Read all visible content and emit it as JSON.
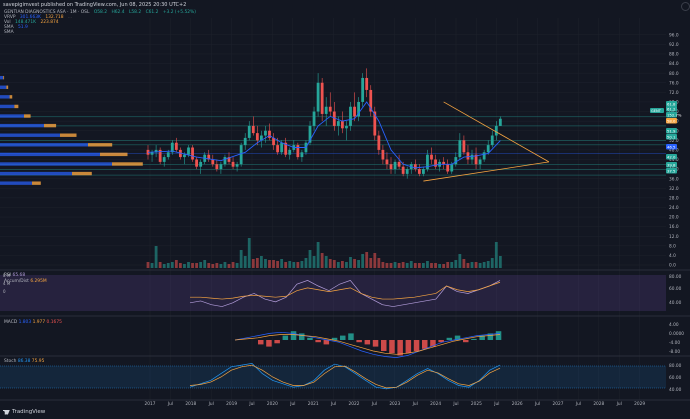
{
  "header": {
    "publisher": "savepigimvest published on TradingView.com, Jun 08, 2025 20:30 UTC+2"
  },
  "legend": {
    "symbol_line": {
      "name": "GENTIAN DIAGNOSTICS ASA · 1M · OSL",
      "o": "O58.2",
      "h": "H62.4",
      "l": "L58.2",
      "c": "C61.2",
      "chg": "+3.2 (+5.52%)"
    },
    "vrvp": {
      "name": "VRVP",
      "values": [
        "301.663K",
        "132.718",
        "..."
      ]
    },
    "vol": {
      "name": "Vol",
      "values": [
        "148.471K",
        "223.874"
      ]
    },
    "sma1": {
      "name": "SMA",
      "value": "51.9"
    },
    "sma2": {
      "name": "SMA",
      "value": ""
    }
  },
  "panes": {
    "rsi_label": {
      "name": "RSI",
      "value": "65.68"
    },
    "accum_label": {
      "name": "Accum/Dist",
      "value": "6.295M"
    },
    "macd_label": {
      "name": "MACD",
      "v1": "1.803",
      "v2": "1.977",
      "v3": "0.1675"
    },
    "stoch_label": {
      "name": "Stoch",
      "v1": "86.38",
      "v2": "75.95"
    }
  },
  "colors": {
    "bg": "#131722",
    "grid": "#1e222d",
    "up": "#26a69a",
    "down": "#ef5350",
    "sma": "#2962ff",
    "trend": "#f7a541",
    "rsi_band": "#7e57c2",
    "stoch_band": "#2196f3",
    "axis_text": "#b2b5be"
  },
  "chart_data": [
    {
      "type": "candlestick",
      "title": "GENTIAN DIAGNOSTICS ASA · 1M · OSL",
      "y_ticks": [
        "96.0",
        "92.0",
        "88.0",
        "84.0",
        "80.0",
        "76.0",
        "72.0",
        "68.0",
        "64.0",
        "60.0",
        "56.0",
        "52.0",
        "48.0",
        "44.0",
        "40.0",
        "36.0",
        "32.0",
        "28.0",
        "24.0",
        "20.0",
        "16.0",
        "12.0",
        "8.0",
        "4.0",
        "0.0"
      ],
      "ylim": [
        0,
        98
      ],
      "x_ticks": [
        "2017",
        "Jul",
        "2018",
        "Jul",
        "2019",
        "Jul",
        "2020",
        "Jul",
        "2021",
        "Jul",
        "2022",
        "Jul",
        "2023",
        "Jul",
        "2024",
        "Jul",
        "2025",
        "Jul",
        "2026",
        "Jul",
        "2027",
        "Jul",
        "2028",
        "Jul",
        "2029"
      ],
      "price_labels": [
        {
          "text": "61.8",
          "color": "#26a69a"
        },
        {
          "text": "61.2",
          "color": "#26a69a"
        },
        {
          "text": "152.7%",
          "color": "#26a69a"
        },
        {
          "text": "58.0",
          "color": "#f7a541"
        },
        {
          "text": "51.9",
          "color": "#26a69a"
        },
        {
          "text": "50.1",
          "color": "#26a69a"
        },
        {
          "text": "46.5",
          "color": "#2962ff"
        },
        {
          "text": "42.0",
          "color": "#26a69a"
        },
        {
          "text": "39.8",
          "color": "#26a69a"
        },
        {
          "text": "37.5",
          "color": "#26a69a"
        }
      ],
      "candles": [
        [
          48,
          50,
          44,
          46
        ],
        [
          46,
          48,
          43,
          47
        ],
        [
          47,
          50,
          45,
          48
        ],
        [
          48,
          49,
          42,
          43
        ],
        [
          43,
          46,
          41,
          45
        ],
        [
          45,
          48,
          44,
          47
        ],
        [
          47,
          52,
          46,
          51
        ],
        [
          51,
          53,
          47,
          48
        ],
        [
          48,
          49,
          44,
          45
        ],
        [
          45,
          47,
          42,
          46
        ],
        [
          46,
          50,
          45,
          49
        ],
        [
          49,
          50,
          43,
          44
        ],
        [
          44,
          45,
          40,
          41
        ],
        [
          41,
          44,
          38,
          43
        ],
        [
          43,
          47,
          42,
          46
        ],
        [
          46,
          48,
          43,
          44
        ],
        [
          44,
          46,
          41,
          42
        ],
        [
          42,
          44,
          39,
          40
        ],
        [
          40,
          43,
          38,
          42
        ],
        [
          42,
          46,
          41,
          45
        ],
        [
          45,
          47,
          42,
          43
        ],
        [
          43,
          45,
          40,
          41
        ],
        [
          41,
          43,
          39,
          42
        ],
        [
          42,
          51,
          41,
          50
        ],
        [
          50,
          55,
          48,
          53
        ],
        [
          53,
          60,
          52,
          58
        ],
        [
          58,
          62,
          54,
          55
        ],
        [
          55,
          58,
          50,
          52
        ],
        [
          52,
          56,
          49,
          54
        ],
        [
          54,
          58,
          51,
          56
        ],
        [
          56,
          59,
          52,
          53
        ],
        [
          53,
          55,
          48,
          50
        ],
        [
          50,
          53,
          46,
          47
        ],
        [
          47,
          52,
          46,
          51
        ],
        [
          51,
          53,
          45,
          46
        ],
        [
          46,
          49,
          44,
          48
        ],
        [
          48,
          52,
          47,
          50
        ],
        [
          50,
          51,
          44,
          45
        ],
        [
          45,
          48,
          43,
          47
        ],
        [
          47,
          52,
          46,
          51
        ],
        [
          51,
          60,
          50,
          58
        ],
        [
          58,
          66,
          56,
          64
        ],
        [
          64,
          80,
          62,
          76
        ],
        [
          76,
          78,
          60,
          63
        ],
        [
          63,
          70,
          58,
          66
        ],
        [
          66,
          72,
          62,
          64
        ],
        [
          64,
          68,
          56,
          58
        ],
        [
          58,
          62,
          54,
          60
        ],
        [
          60,
          64,
          55,
          57
        ],
        [
          57,
          60,
          52,
          58
        ],
        [
          58,
          68,
          56,
          66
        ],
        [
          66,
          72,
          60,
          62
        ],
        [
          62,
          70,
          60,
          68
        ],
        [
          68,
          80,
          66,
          78
        ],
        [
          78,
          82,
          70,
          73
        ],
        [
          73,
          75,
          62,
          64
        ],
        [
          64,
          66,
          52,
          54
        ],
        [
          54,
          56,
          46,
          48
        ],
        [
          48,
          50,
          42,
          44
        ],
        [
          44,
          47,
          40,
          42
        ],
        [
          42,
          45,
          38,
          40
        ],
        [
          40,
          44,
          38,
          43
        ],
        [
          43,
          46,
          40,
          41
        ],
        [
          41,
          43,
          37,
          38
        ],
        [
          38,
          41,
          36,
          40
        ],
        [
          40,
          43,
          38,
          42
        ],
        [
          42,
          44,
          39,
          40
        ],
        [
          40,
          42,
          37,
          38
        ],
        [
          38,
          41,
          37,
          40
        ],
        [
          40,
          48,
          39,
          46
        ],
        [
          46,
          49,
          42,
          44
        ],
        [
          44,
          46,
          40,
          41
        ],
        [
          41,
          44,
          39,
          43
        ],
        [
          43,
          45,
          40,
          42
        ],
        [
          42,
          44,
          38,
          39
        ],
        [
          39,
          43,
          38,
          42
        ],
        [
          42,
          47,
          41,
          45
        ],
        [
          45,
          55,
          44,
          52
        ],
        [
          52,
          54,
          46,
          47
        ],
        [
          47,
          50,
          42,
          44
        ],
        [
          44,
          48,
          42,
          46
        ],
        [
          46,
          49,
          40,
          42
        ],
        [
          42,
          45,
          40,
          44
        ],
        [
          44,
          48,
          43,
          47
        ],
        [
          47,
          52,
          46,
          50
        ],
        [
          50,
          56,
          49,
          54
        ],
        [
          54,
          60,
          52,
          58
        ],
        [
          58,
          62,
          58,
          61
        ]
      ],
      "sma": [
        [
          0,
          47
        ],
        [
          6,
          47.5
        ],
        [
          12,
          45
        ],
        [
          18,
          43.5
        ],
        [
          24,
          47
        ],
        [
          27,
          51
        ],
        [
          30,
          54
        ],
        [
          33,
          51
        ],
        [
          36,
          49
        ],
        [
          39,
          49
        ],
        [
          42,
          58
        ],
        [
          45,
          62
        ],
        [
          48,
          60
        ],
        [
          51,
          61
        ],
        [
          54,
          68
        ],
        [
          57,
          60
        ],
        [
          60,
          48
        ],
        [
          63,
          42
        ],
        [
          66,
          40.5
        ],
        [
          69,
          41
        ],
        [
          72,
          42
        ],
        [
          75,
          42
        ],
        [
          78,
          45
        ],
        [
          81,
          45.5
        ],
        [
          84,
          46.5
        ],
        [
          87,
          51.9
        ]
      ],
      "trendlines": [
        [
          [
            73,
            68
          ],
          [
            99,
            43
          ]
        ],
        [
          [
            68,
            35
          ],
          [
            99,
            43
          ]
        ]
      ],
      "volume_profile": [
        [
          78,
          4
        ],
        [
          74,
          8
        ],
        [
          70,
          12
        ],
        [
          66,
          18
        ],
        [
          62,
          30
        ],
        [
          58,
          55
        ],
        [
          54,
          75
        ],
        [
          50,
          110
        ],
        [
          46,
          125
        ],
        [
          42,
          140
        ],
        [
          38,
          90
        ],
        [
          34,
          40
        ]
      ]
    },
    {
      "type": "bar",
      "title": "Vol",
      "values": [
        0.6,
        0.5,
        2.2,
        0.6,
        0.4,
        0.5,
        0.6,
        0.8,
        0.5,
        0.4,
        0.6,
        0.5,
        0.5,
        0.6,
        0.8,
        0.5,
        0.4,
        0.5,
        0.4,
        0.6,
        0.4,
        0.6,
        0.5,
        1.8,
        1.2,
        3.0,
        0.9,
        1.0,
        1.2,
        0.9,
        0.8,
        0.8,
        0.7,
        0.9,
        0.6,
        0.7,
        0.6,
        0.6,
        0.7,
        1.0,
        1.8,
        1.2,
        2.6,
        1.5,
        1.2,
        0.9,
        0.8,
        0.6,
        0.7,
        0.6,
        1.1,
        0.9,
        0.8,
        1.4,
        1.6,
        1.0,
        1.5,
        1.0,
        0.6,
        0.5,
        0.5,
        0.6,
        0.5,
        0.6,
        0.5,
        0.7,
        0.5,
        0.5,
        0.5,
        0.7,
        0.5,
        0.5,
        0.4,
        0.4,
        0.6,
        0.6,
        0.8,
        1.4,
        0.9,
        0.5,
        0.6,
        0.6,
        0.5,
        0.6,
        0.7,
        1.0,
        2.6,
        1.2
      ]
    },
    {
      "type": "line",
      "title": "RSI",
      "y_ticks": [
        "8 M",
        "4 M",
        "0"
      ],
      "series": [
        {
          "name": "RSI",
          "values": [
            42,
            44,
            40,
            38,
            42,
            48,
            52,
            46,
            43,
            48,
            62,
            66,
            60,
            55,
            62,
            66,
            52,
            46,
            40,
            38,
            40,
            42,
            44,
            46,
            60,
            54,
            52,
            56,
            60,
            66
          ]
        },
        {
          "name": "Accum/Dist",
          "values": [
            48,
            48,
            47,
            46,
            47,
            49,
            50,
            49,
            48,
            49,
            55,
            58,
            56,
            54,
            56,
            58,
            52,
            48,
            46,
            46,
            47,
            48,
            50,
            52,
            60,
            56,
            54,
            56,
            60,
            64
          ]
        }
      ]
    },
    {
      "type": "bar",
      "title": "MACD",
      "y_ticks": [
        "4.00",
        "0.0000",
        "-4.00",
        "-8.00"
      ],
      "values": [
        -2,
        -3,
        -1.5,
        2,
        4,
        3,
        1,
        -1,
        -2,
        1,
        2,
        3,
        -1,
        -2,
        -3,
        -5,
        -6,
        -7,
        -6,
        -5,
        -4,
        -3,
        -1,
        1,
        2,
        -1,
        0.5,
        2,
        3,
        4
      ],
      "series": [
        {
          "name": "MACD",
          "values": [
            0,
            1,
            2,
            3,
            3.5,
            3,
            2,
            1,
            0,
            -1,
            -3,
            -5,
            -6.5,
            -7.5,
            -8,
            -7,
            -5,
            -3,
            -1,
            0,
            1,
            2,
            2.5,
            3
          ]
        },
        {
          "name": "Signal",
          "values": [
            0,
            0.5,
            1,
            2,
            2.5,
            2.5,
            2,
            1.5,
            0.5,
            -0.5,
            -2,
            -3.5,
            -5,
            -6,
            -6.5,
            -6,
            -5,
            -3.5,
            -2,
            -0.5,
            0.5,
            1.5,
            2,
            2.5
          ]
        }
      ]
    },
    {
      "type": "line",
      "title": "Stoch",
      "y_ticks": [
        "80.00",
        "60.00",
        "40.00"
      ],
      "series": [
        {
          "name": "Stoch",
          "values": [
            20,
            30,
            40,
            60,
            80,
            85,
            90,
            60,
            40,
            30,
            20,
            25,
            40,
            70,
            88,
            80,
            60,
            40,
            20,
            15,
            20,
            40,
            60,
            75,
            60,
            40,
            25,
            20,
            40,
            70,
            85
          ]
        },
        {
          "name": "Signal",
          "values": [
            25,
            28,
            35,
            50,
            70,
            80,
            85,
            70,
            50,
            35,
            25,
            25,
            35,
            60,
            80,
            82,
            65,
            45,
            28,
            18,
            20,
            35,
            55,
            70,
            62,
            45,
            30,
            25,
            38,
            62,
            76
          ]
        }
      ]
    }
  ]
}
